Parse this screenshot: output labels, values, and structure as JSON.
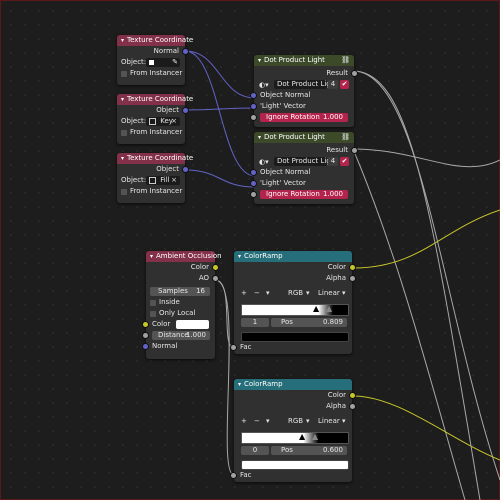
{
  "texture_coordinate": {
    "title": "Texture Coordinate",
    "object_label": "Object:",
    "from_instancer_label": "From Instancer",
    "nodes": [
      {
        "output": "Normal",
        "object_value": ""
      },
      {
        "output": "Object",
        "object_value": "Key"
      },
      {
        "output": "Object",
        "object_value": "Fill"
      }
    ]
  },
  "dot_product": {
    "title": "Dot Product Light",
    "group_name": "Dot Product Light",
    "users": "4",
    "result_label": "Result",
    "input1": "Object Normal",
    "input2": "'Light' Vector",
    "ignore_rotation_label": "Ignore Rotation",
    "ignore_rotation_value": "1.000"
  },
  "ambient_occlusion": {
    "title": "Ambient Occlusion",
    "color_out": "Color",
    "ao_out": "AO",
    "samples_label": "Samples",
    "samples_value": "16",
    "inside_label": "Inside",
    "only_local_label": "Only Local",
    "color_in": "Color",
    "distance_label": "Distance",
    "distance_value": "1.000",
    "normal_in": "Normal"
  },
  "colorramp": {
    "title": "ColorRamp",
    "color_out": "Color",
    "alpha_out": "Alpha",
    "add_label": "+",
    "remove_label": "−",
    "mode": "RGB",
    "interpolation": "Linear",
    "pos_label": "Pos",
    "fac_label": "Fac",
    "nodes": [
      {
        "index": "1",
        "pos": "0.809"
      },
      {
        "index": "0",
        "pos": "0.600"
      }
    ]
  },
  "icons": [
    "chevron-down-icon",
    "eyedropper-icon",
    "node-tree-icon",
    "shield-icon",
    "close-icon"
  ]
}
